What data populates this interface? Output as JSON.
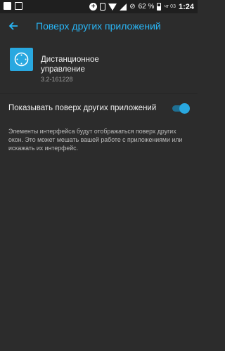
{
  "statusbar": {
    "battery": "62 %",
    "date": "чт 03",
    "time": "1:24",
    "icons": [
      "square-icon",
      "image-icon",
      "plus-circle-icon",
      "vibrate-icon",
      "wifi-icon",
      "signal-icon",
      "no-sim-icon",
      "battery-icon"
    ]
  },
  "appbar": {
    "title": "Поверх других приложений",
    "accent": "#29b6f6",
    "back_icon": "arrow-back-icon"
  },
  "app": {
    "name": "Дистанционное управление",
    "version": "3.2-161228",
    "icon": "remote-control-icon",
    "icon_color": "#29a8e0"
  },
  "setting": {
    "label": "Показывать поверх других приложений",
    "enabled": true
  },
  "description": "Элементы интерфейса будут отображаться поверх других окон. Это может мешать вашей работе с приложениями или искажать их интерфейс."
}
